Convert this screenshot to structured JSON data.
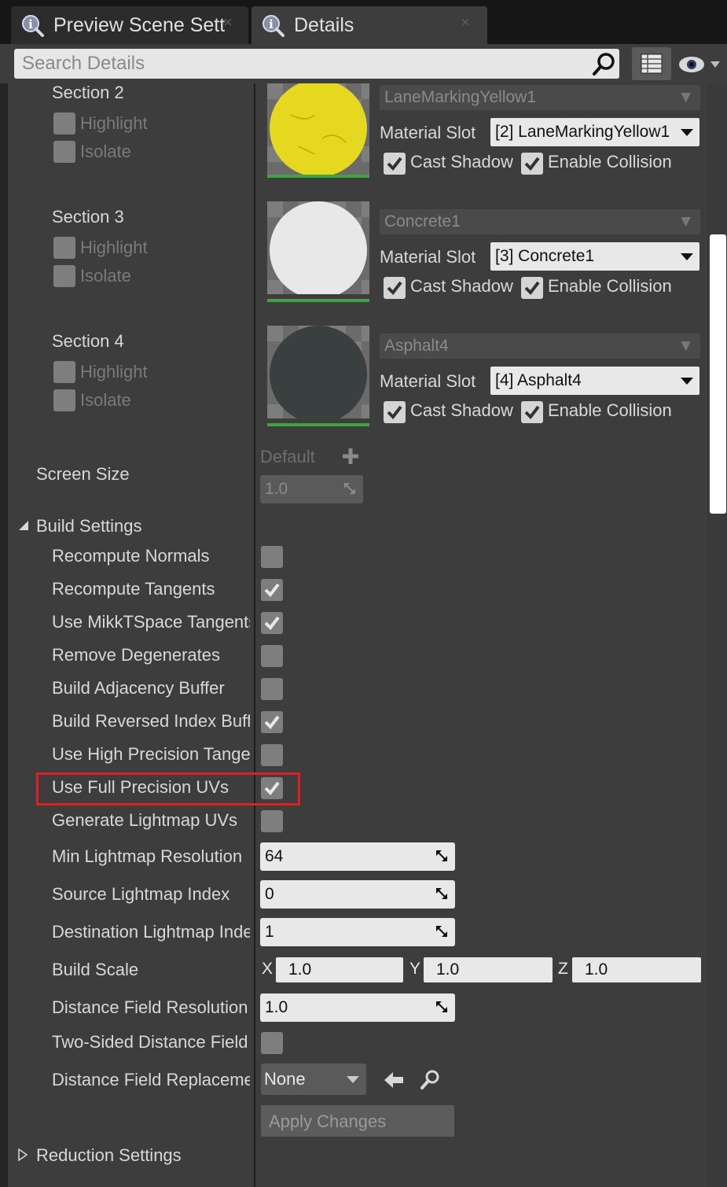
{
  "tabs": [
    {
      "label": "Preview Scene Sett",
      "close": "×"
    },
    {
      "label": "Details",
      "close": "×"
    }
  ],
  "search": {
    "placeholder": "Search Details"
  },
  "sections": [
    {
      "label": "Section 2",
      "highlight": "Highlight",
      "isolate": "Isolate"
    },
    {
      "label": "Section 3",
      "highlight": "Highlight",
      "isolate": "Isolate"
    },
    {
      "label": "Section 4",
      "highlight": "Highlight",
      "isolate": "Isolate"
    }
  ],
  "materials": [
    {
      "name": "LaneMarkingYellow1",
      "slot_label": "Material Slot",
      "slot_value": "[2] LaneMarkingYellow1",
      "cast_shadow": "Cast Shadow",
      "enable_collision": "Enable Collision",
      "sphere_color": "#e6d81e"
    },
    {
      "name": "Concrete1",
      "slot_label": "Material Slot",
      "slot_value": "[3] Concrete1",
      "cast_shadow": "Cast Shadow",
      "enable_collision": "Enable Collision",
      "sphere_color": "#e8e8e8"
    },
    {
      "name": "Asphalt4",
      "slot_label": "Material Slot",
      "slot_value": "[4] Asphalt4",
      "cast_shadow": "Cast Shadow",
      "enable_collision": "Enable Collision",
      "sphere_color": "#3a3f40"
    }
  ],
  "screen_size": {
    "label": "Screen Size",
    "default_label": "Default",
    "value": "1.0"
  },
  "build_settings": {
    "header": "Build Settings",
    "options": [
      {
        "label": "Recompute Normals",
        "checked": false
      },
      {
        "label": "Recompute Tangents",
        "checked": true
      },
      {
        "label": "Use MikkTSpace Tangents",
        "checked": true
      },
      {
        "label": "Remove Degenerates",
        "checked": false
      },
      {
        "label": "Build Adjacency Buffer",
        "checked": false
      },
      {
        "label": "Build Reversed Index Buffer",
        "checked": true
      },
      {
        "label": "Use High Precision Tangents",
        "checked": false
      },
      {
        "label": "Use Full Precision UVs",
        "checked": true
      },
      {
        "label": "Generate Lightmap UVs",
        "checked": false
      }
    ],
    "min_lightmap_resolution": {
      "label": "Min Lightmap Resolution",
      "value": "64"
    },
    "source_lightmap_index": {
      "label": "Source Lightmap Index",
      "value": "0"
    },
    "destination_lightmap_index": {
      "label": "Destination Lightmap Index",
      "value": "1"
    },
    "build_scale": {
      "label": "Build Scale",
      "x": "1.0",
      "y": "1.0",
      "z": "1.0",
      "x_axis": "X",
      "y_axis": "Y",
      "z_axis": "Z"
    },
    "distance_field_resolution": {
      "label": "Distance Field Resolution",
      "value": "1.0"
    },
    "two_sided_distance_field": {
      "label": "Two-Sided Distance Field",
      "checked": false
    },
    "distance_field_replacement": {
      "label": "Distance Field Replacement",
      "value": "None"
    },
    "apply_changes": "Apply Changes"
  },
  "reduction_settings": {
    "header": "Reduction Settings"
  },
  "highlight_box": {
    "color": "#e02020"
  }
}
